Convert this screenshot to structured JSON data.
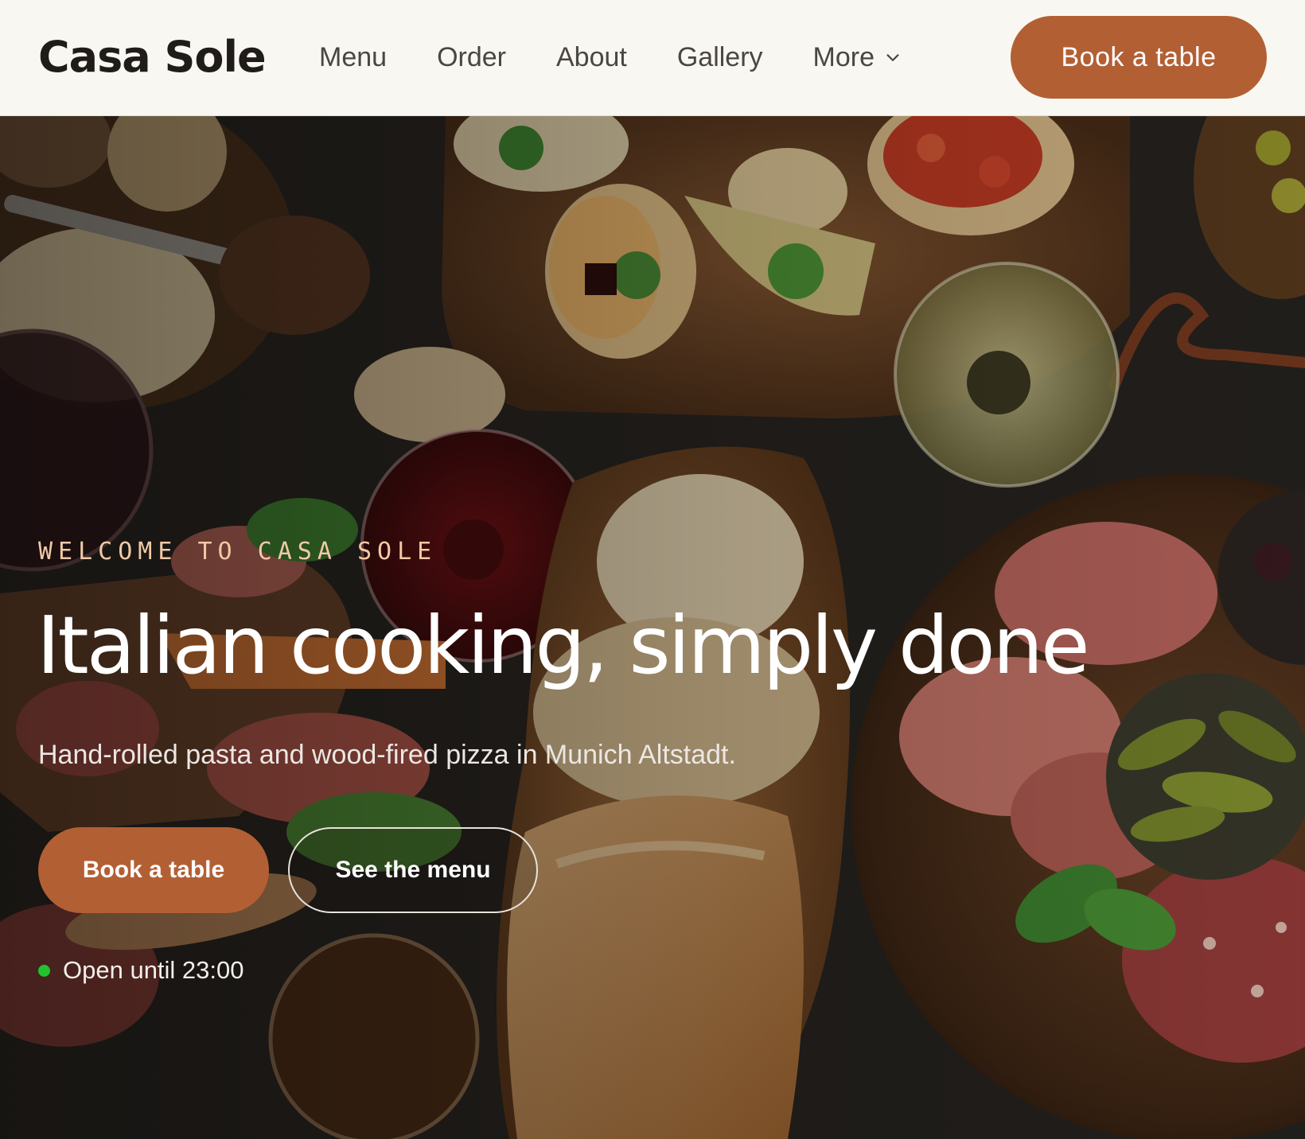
{
  "header": {
    "brand": "Casa Sole",
    "nav": [
      "Menu",
      "Order",
      "About",
      "Gallery",
      "More"
    ],
    "cta_label": "Book a table"
  },
  "hero": {
    "eyebrow": "WELCOME TO CASA SOLE",
    "title": "Italian cooking, simply done",
    "subtitle": "Hand-rolled pasta and wood-fired pizza in Munich Altstadt.",
    "primary_button": "Book a table",
    "secondary_button": "See the menu",
    "status_text": "Open until 23:00"
  },
  "colors": {
    "accent": "#b35f34",
    "header_bg": "#f9f7f2",
    "eyebrow": "#f1c9a6",
    "status_open": "#22c32e"
  },
  "icons": {
    "more_dropdown": "chevron-down-icon",
    "status": "status-dot-icon"
  }
}
